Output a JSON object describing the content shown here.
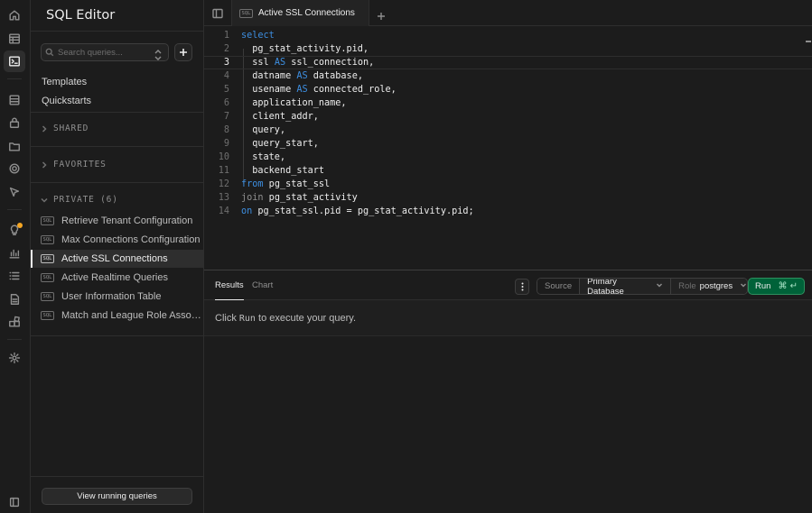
{
  "rail": {
    "icons": [
      "home-icon",
      "table-editor-icon",
      "sql-editor-icon",
      "database-icon",
      "auth-icon",
      "storage-icon",
      "realtime-icon",
      "edge-functions-icon",
      "advisors-icon",
      "reports-icon",
      "logs-icon",
      "api-docs-icon",
      "integrations-icon",
      "settings-icon",
      "sidebar-expand-icon"
    ]
  },
  "sidebar": {
    "title": "SQL Editor",
    "search_placeholder": "Search queries...",
    "links": [
      "Templates",
      "Quickstarts"
    ],
    "sections": {
      "shared": "SHARED",
      "favorites": "FAVORITES",
      "private": "PRIVATE (6)"
    },
    "queries": [
      {
        "label": "Retrieve Tenant Configuration",
        "active": false
      },
      {
        "label": "Max Connections Configuration",
        "active": false
      },
      {
        "label": "Active SSL Connections",
        "active": true
      },
      {
        "label": "Active Realtime Queries",
        "active": false
      },
      {
        "label": "User Information Table",
        "active": false
      },
      {
        "label": "Match and League Role Associations",
        "active": false
      }
    ],
    "sql_badge": "SQL",
    "view_running": "View running queries"
  },
  "tabs": {
    "active": "Active SSL Connections"
  },
  "editor": {
    "lines": [
      {
        "n": "1",
        "tokens": [
          {
            "t": "select",
            "k": "kw"
          }
        ]
      },
      {
        "n": "2",
        "tokens": [
          {
            "t": "  pg_stat_activity.pid,",
            "k": ""
          }
        ]
      },
      {
        "n": "3",
        "tokens": [
          {
            "t": "  ssl ",
            "k": ""
          },
          {
            "t": "AS",
            "k": "kw"
          },
          {
            "t": " ssl_connection,",
            "k": ""
          }
        ]
      },
      {
        "n": "4",
        "tokens": [
          {
            "t": "  datname ",
            "k": ""
          },
          {
            "t": "AS",
            "k": "kw"
          },
          {
            "t": " database,",
            "k": ""
          }
        ]
      },
      {
        "n": "5",
        "tokens": [
          {
            "t": "  usename ",
            "k": ""
          },
          {
            "t": "AS",
            "k": "kw"
          },
          {
            "t": " connected_role,",
            "k": ""
          }
        ]
      },
      {
        "n": "6",
        "tokens": [
          {
            "t": "  application_name,",
            "k": ""
          }
        ]
      },
      {
        "n": "7",
        "tokens": [
          {
            "t": "  client_addr,",
            "k": ""
          }
        ]
      },
      {
        "n": "8",
        "tokens": [
          {
            "t": "  query,",
            "k": ""
          }
        ]
      },
      {
        "n": "9",
        "tokens": [
          {
            "t": "  query_start,",
            "k": ""
          }
        ]
      },
      {
        "n": "10",
        "tokens": [
          {
            "t": "  state,",
            "k": ""
          }
        ]
      },
      {
        "n": "11",
        "tokens": [
          {
            "t": "  backend_start",
            "k": ""
          }
        ]
      },
      {
        "n": "12",
        "tokens": [
          {
            "t": "from",
            "k": "kw"
          },
          {
            "t": " pg_stat_ssl",
            "k": ""
          }
        ]
      },
      {
        "n": "13",
        "tokens": [
          {
            "t": "join",
            "k": "kw-dim"
          },
          {
            "t": " pg_stat_activity",
            "k": ""
          }
        ]
      },
      {
        "n": "14",
        "tokens": [
          {
            "t": "on",
            "k": "kw"
          },
          {
            "t": " pg_stat_ssl.pid = pg_stat_activity.pid;",
            "k": ""
          }
        ]
      }
    ],
    "current_line": 3
  },
  "results": {
    "tabs": [
      "Results",
      "Chart"
    ],
    "source_label": "Source",
    "database": "Primary Database",
    "role_key": "Role",
    "role_value": "postgres",
    "run_label": "Run",
    "run_shortcut": "⌘ ↵",
    "message_prefix": "Click ",
    "message_run": "Run",
    "message_suffix": " to execute your query."
  },
  "colors": {
    "keyword": "#3d8ee0",
    "run_button": "#006239",
    "background": "#1c1c1c"
  }
}
